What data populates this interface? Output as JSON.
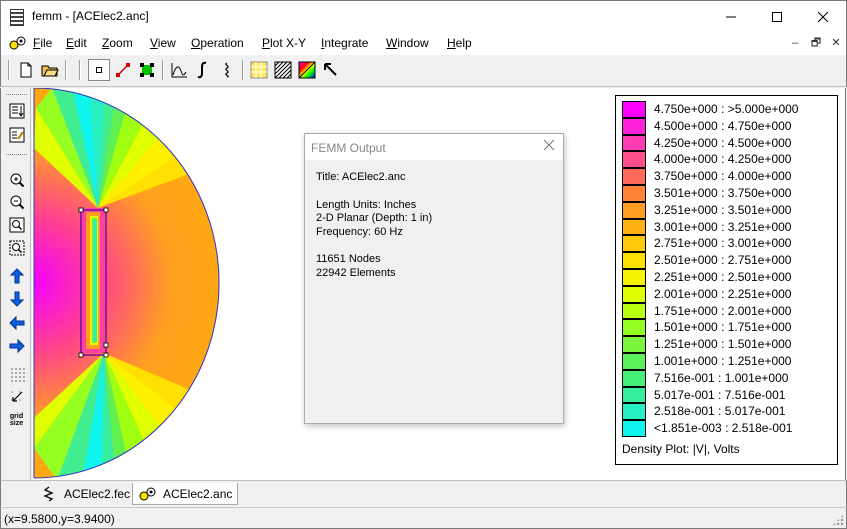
{
  "window": {
    "title": "femm - [ACElec2.anc]",
    "controls": [
      "minimize-icon",
      "maximize-icon",
      "close-icon"
    ]
  },
  "menu": {
    "items": [
      {
        "label": "File",
        "accel": "F"
      },
      {
        "label": "Edit",
        "accel": "E"
      },
      {
        "label": "Zoom",
        "accel": "Z"
      },
      {
        "label": "View",
        "accel": "V"
      },
      {
        "label": "Operation",
        "accel": "O"
      },
      {
        "label": "Plot X-Y",
        "accel": "P"
      },
      {
        "label": "Integrate",
        "accel": "I"
      },
      {
        "label": "Window",
        "accel": "W"
      },
      {
        "label": "Help",
        "accel": "H"
      }
    ],
    "mdi_controls": [
      "–",
      "🗗",
      "✕"
    ]
  },
  "toolbar": {
    "buttons": [
      "new-file-icon",
      "open-folder-icon",
      "point-mode-icon",
      "line-mode-icon",
      "block-mode-icon",
      "plot-xy-icon",
      "integral-icon",
      "contour-icon",
      "density-plot-icon",
      "hatch-plot-icon",
      "vector-plot-icon",
      "pointer-icon"
    ]
  },
  "lefttoolbar": {
    "buttons": [
      "show-mesh-icon",
      "edit-props-icon",
      "zoom-in-icon",
      "zoom-out-icon",
      "zoom-natural-icon",
      "zoom-window-icon",
      "pan-up-icon",
      "pan-down-icon",
      "pan-left-icon",
      "pan-right-icon",
      "show-grid-icon",
      "snap-grid-icon",
      "grid-size-icon"
    ],
    "grid_size_label": "grid\nsize"
  },
  "legend": {
    "rows": [
      {
        "label": "4.750e+000 : >5.000e+000",
        "color": "#ff00ff"
      },
      {
        "label": "4.500e+000 : 4.750e+000",
        "color": "#ff22d8"
      },
      {
        "label": "4.250e+000 : 4.500e+000",
        "color": "#ff3cb4"
      },
      {
        "label": "4.000e+000 : 4.250e+000",
        "color": "#ff508c"
      },
      {
        "label": "3.750e+000 : 4.000e+000",
        "color": "#ff6a5a"
      },
      {
        "label": "3.501e+000 : 3.750e+000",
        "color": "#ff8438"
      },
      {
        "label": "3.251e+000 : 3.501e+000",
        "color": "#ff9c22"
      },
      {
        "label": "3.001e+000 : 3.251e+000",
        "color": "#ffb012"
      },
      {
        "label": "2.751e+000 : 3.001e+000",
        "color": "#ffc808"
      },
      {
        "label": "2.501e+000 : 2.751e+000",
        "color": "#ffe000"
      },
      {
        "label": "2.251e+000 : 2.501e+000",
        "color": "#f6f200"
      },
      {
        "label": "2.001e+000 : 2.251e+000",
        "color": "#deff00"
      },
      {
        "label": "1.751e+000 : 2.001e+000",
        "color": "#b8ff10"
      },
      {
        "label": "1.501e+000 : 1.751e+000",
        "color": "#96ff22"
      },
      {
        "label": "1.251e+000 : 1.501e+000",
        "color": "#78f53c"
      },
      {
        "label": "1.001e+000 : 1.251e+000",
        "color": "#5cf05a"
      },
      {
        "label": "7.516e-001 : 1.001e+000",
        "color": "#46ee7a"
      },
      {
        "label": "5.017e-001 : 7.516e-001",
        "color": "#36ee9e"
      },
      {
        "label": "2.518e-001 : 5.017e-001",
        "color": "#28f0c4"
      },
      {
        "label": "<1.851e-003 : 2.518e-001",
        "color": "#10f4ee"
      }
    ],
    "title": "Density Plot: |V|, Volts"
  },
  "output_dialog": {
    "title": "FEMM Output",
    "lines": [
      "Title: ACElec2.anc",
      "",
      "Length Units: Inches",
      "2-D Planar (Depth: 1 in)",
      "Frequency: 60 Hz",
      "",
      "11651 Nodes",
      "22942 Elements"
    ]
  },
  "tabs": [
    {
      "label": "ACElec2.fec",
      "icon": "fec-file-icon",
      "active": false
    },
    {
      "label": "ACElec2.anc",
      "icon": "anc-file-icon",
      "active": true
    }
  ],
  "status": {
    "coords": "(x=9.5800,y=3.9400)"
  }
}
